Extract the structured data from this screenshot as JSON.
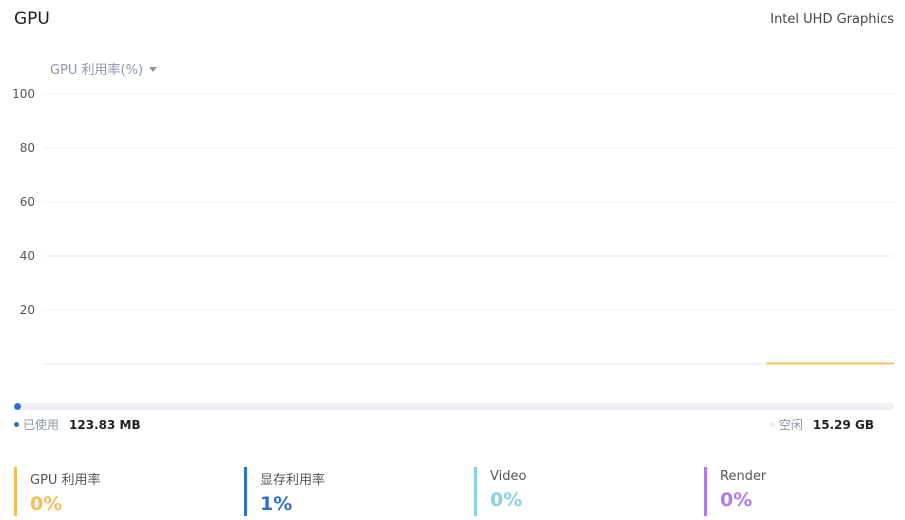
{
  "header": {
    "title": "GPU",
    "device_name": "Intel UHD Graphics"
  },
  "metric_select": {
    "label": "GPU 利用率(%)",
    "icon": "caret-down-icon"
  },
  "chart_data": {
    "type": "line",
    "ylim": [
      0,
      100
    ],
    "yticks": [
      "20",
      "40",
      "60",
      "80",
      "100"
    ],
    "grid": true,
    "series": [
      {
        "color": "#f5bc5a",
        "x": [
          0.85,
          1.0
        ],
        "values": [
          0,
          0
        ]
      }
    ]
  },
  "memory": {
    "used_fraction": 0.008,
    "used_label": "已使用",
    "used_value": "123.83 MB",
    "free_label": "空闲",
    "free_value": "15.29 GB",
    "used_color": "#2f6fd1"
  },
  "stats": [
    {
      "label": "GPU 利用率",
      "value": "0%",
      "color": "#f5bc5a"
    },
    {
      "label": "显存利用率",
      "value": "1%",
      "color": "#2f6fd1"
    },
    {
      "label": "Video",
      "value": "0%",
      "color": "#86d2e4"
    },
    {
      "label": "Render",
      "value": "0%",
      "color": "#b07ae8"
    }
  ]
}
